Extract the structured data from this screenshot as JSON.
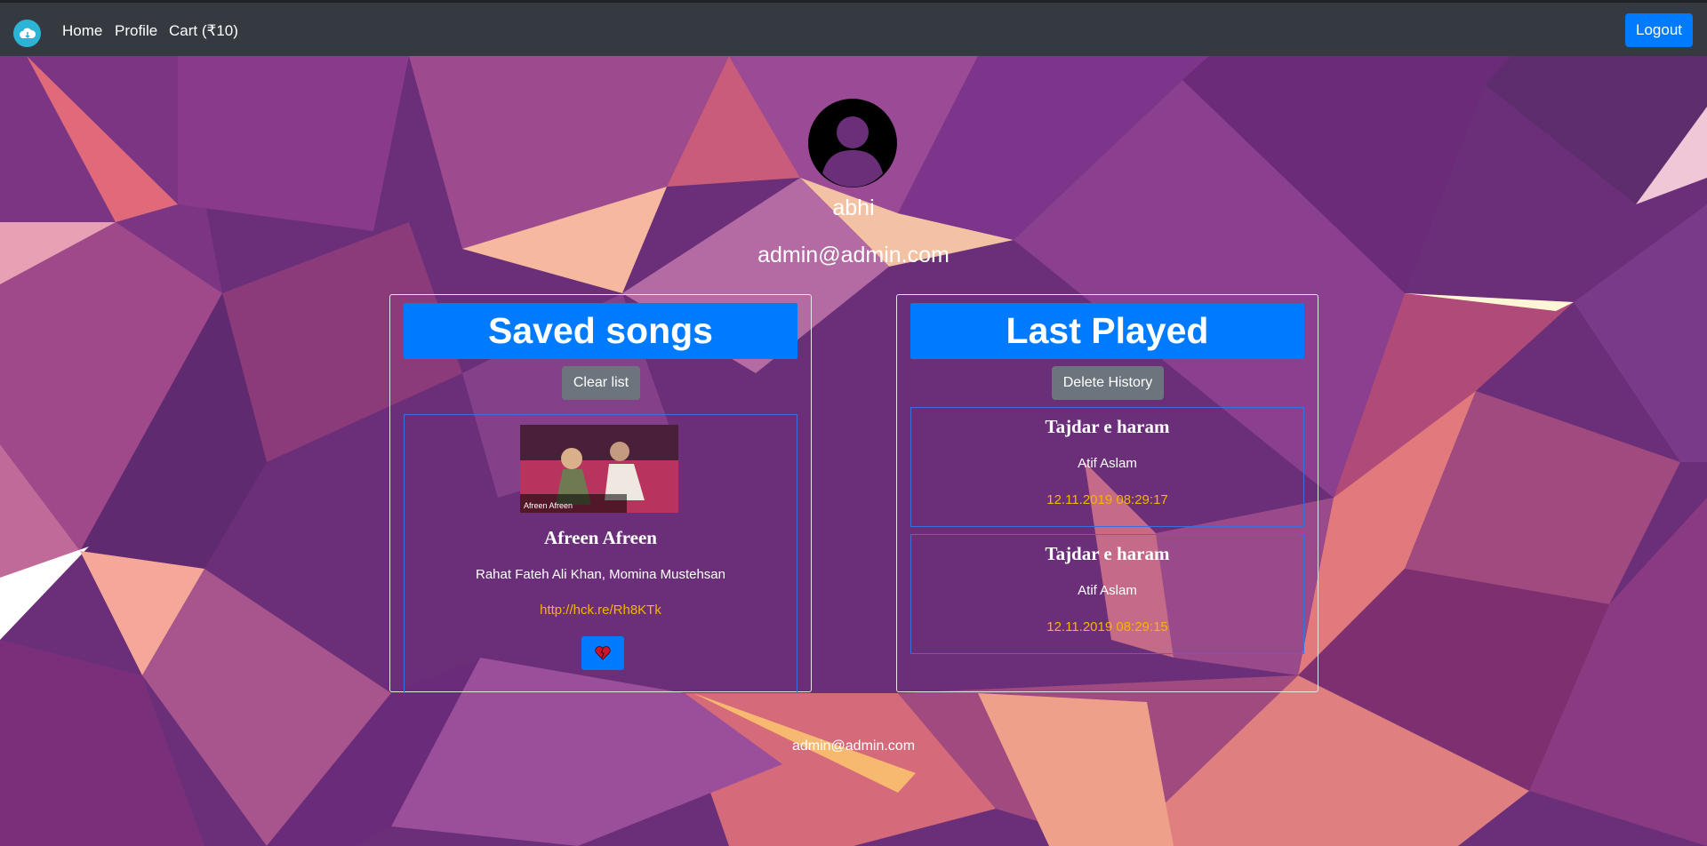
{
  "nav": {
    "logo_icon": "cloud-music-icon",
    "links": [
      "Home",
      "Profile",
      "Cart (₹10)"
    ],
    "logout_label": "Logout"
  },
  "profile": {
    "avatar_icon": "user-avatar-icon",
    "username": "abhi",
    "email": "admin@admin.com"
  },
  "saved_songs": {
    "header": "Saved songs",
    "clear_label": "Clear list",
    "items": [
      {
        "thumbnail_caption": "Afreen Afreen",
        "title": "Afreen Afreen",
        "artist": "Rahat Fateh Ali Khan, Momina Mustehsan",
        "link": "http://hck.re/Rh8KTk",
        "unsave_icon": "broken-heart-icon"
      }
    ]
  },
  "last_played": {
    "header": "Last Played",
    "delete_label": "Delete History",
    "items": [
      {
        "title": "Tajdar e haram",
        "artist": "Atif Aslam",
        "time": "12.11.2019 08:29:17"
      },
      {
        "title": "Tajdar e haram",
        "artist": "Atif Aslam",
        "time": "12.11.2019 08:29:15"
      }
    ]
  },
  "footer": {
    "email": "admin@admin.com"
  },
  "colors": {
    "navbar": "#343a40",
    "primary": "#007bff",
    "secondary": "#6c757d",
    "accent_text": "#f7b500",
    "background": "#6a2f78"
  }
}
